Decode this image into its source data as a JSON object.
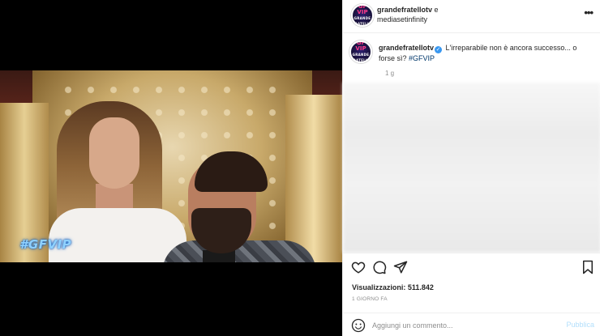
{
  "media": {
    "overlay_tag": "#GFVIP"
  },
  "header": {
    "account_primary": "grandefratellotv",
    "conjunction": " e",
    "account_secondary": "mediasetinfinity",
    "more_label": "•••"
  },
  "avatar": {
    "logo_main": "GF VIP",
    "logo_sub": "GRANDE FRATELLO"
  },
  "caption": {
    "username": "grandefratellotv",
    "verified_glyph": "✓",
    "text": " L'irreparabile non è ancora successo... o forse sì? ",
    "hashtag": "#GFVIP",
    "time": "1 g"
  },
  "actions": {
    "views_label": "Visualizzazioni:",
    "views_count": "511.842",
    "posted": "1 GIORNO FA"
  },
  "comment": {
    "placeholder": "Aggiungi un commento...",
    "publish_label": "Pubblica"
  },
  "colors": {
    "link": "#00376b",
    "verified": "#3897f0",
    "publish_disabled": "#b2dffc",
    "muted": "#8e8e8e"
  }
}
